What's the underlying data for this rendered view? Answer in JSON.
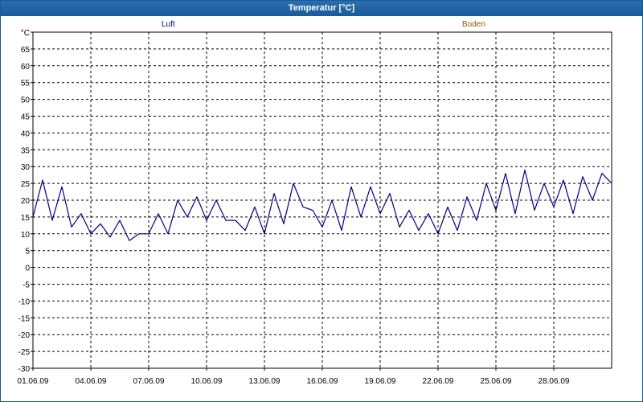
{
  "window": {
    "title": "Temperatur [°C]"
  },
  "colors": {
    "titlebar": "#1c5a96",
    "luft": "#00008b",
    "boden": "#8b5a00",
    "grid": "#000000"
  },
  "chart_data": {
    "type": "line",
    "title": "Temperatur [°C]",
    "ylabel": "°C",
    "xlabel": "",
    "ylim": [
      -30,
      70
    ],
    "xlim": [
      "01.06.09 00:00",
      "01.07.09 00:00"
    ],
    "grid": true,
    "legend_placement": "top",
    "y_ticks": [
      "°C",
      "65",
      "60",
      "55",
      "50",
      "45",
      "40",
      "35",
      "30",
      "25",
      "20",
      "15",
      "10",
      "5",
      "0",
      "-5",
      "-10",
      "-15",
      "-20",
      "-25",
      "-30"
    ],
    "x_ticks": [
      "01.06.09",
      "04.06.09",
      "07.06.09",
      "10.06.09",
      "13.06.09",
      "16.06.09",
      "19.06.09",
      "22.06.09",
      "25.06.09",
      "28.06.09"
    ],
    "series": [
      {
        "name": "Luft",
        "color": "#00008b",
        "x": [
          "01.06.09 00:00",
          "01.06.09 12:00",
          "02.06.09 00:00",
          "02.06.09 12:00",
          "03.06.09 00:00",
          "03.06.09 12:00",
          "04.06.09 00:00",
          "04.06.09 12:00",
          "05.06.09 00:00",
          "05.06.09 12:00",
          "06.06.09 00:00",
          "06.06.09 12:00",
          "07.06.09 00:00",
          "07.06.09 12:00",
          "08.06.09 00:00",
          "08.06.09 12:00",
          "09.06.09 00:00",
          "09.06.09 12:00",
          "10.06.09 00:00",
          "10.06.09 12:00",
          "11.06.09 00:00",
          "11.06.09 12:00",
          "12.06.09 00:00",
          "12.06.09 12:00",
          "13.06.09 00:00",
          "13.06.09 12:00",
          "14.06.09 00:00",
          "14.06.09 12:00",
          "15.06.09 00:00",
          "15.06.09 12:00",
          "16.06.09 00:00",
          "16.06.09 12:00",
          "17.06.09 00:00",
          "17.06.09 12:00",
          "18.06.09 00:00",
          "18.06.09 12:00",
          "19.06.09 00:00",
          "19.06.09 12:00",
          "20.06.09 00:00",
          "20.06.09 12:00",
          "21.06.09 00:00",
          "21.06.09 12:00",
          "22.06.09 00:00",
          "22.06.09 12:00",
          "23.06.09 00:00",
          "23.06.09 12:00",
          "24.06.09 00:00",
          "24.06.09 12:00",
          "25.06.09 00:00",
          "25.06.09 12:00",
          "26.06.09 00:00",
          "26.06.09 12:00",
          "27.06.09 00:00",
          "27.06.09 12:00",
          "28.06.09 00:00",
          "28.06.09 12:00",
          "29.06.09 00:00",
          "29.06.09 12:00",
          "30.06.09 00:00",
          "30.06.09 12:00",
          "01.07.09 00:00"
        ],
        "values": [
          15,
          26,
          14,
          24,
          12,
          16,
          10,
          13,
          9,
          14,
          8,
          10,
          10,
          16,
          10,
          20,
          15,
          21,
          14,
          20,
          14,
          14,
          11,
          18,
          10,
          22,
          13,
          25,
          18,
          17,
          12,
          20,
          11,
          24,
          15,
          24,
          16,
          22,
          12,
          17,
          11,
          16,
          10,
          18,
          11,
          21,
          14,
          25,
          17,
          28,
          16,
          29,
          17,
          25,
          18,
          26,
          16,
          27,
          20,
          28,
          25
        ]
      },
      {
        "name": "Boden",
        "color": "#8b5a00",
        "x": [],
        "values": []
      }
    ]
  }
}
